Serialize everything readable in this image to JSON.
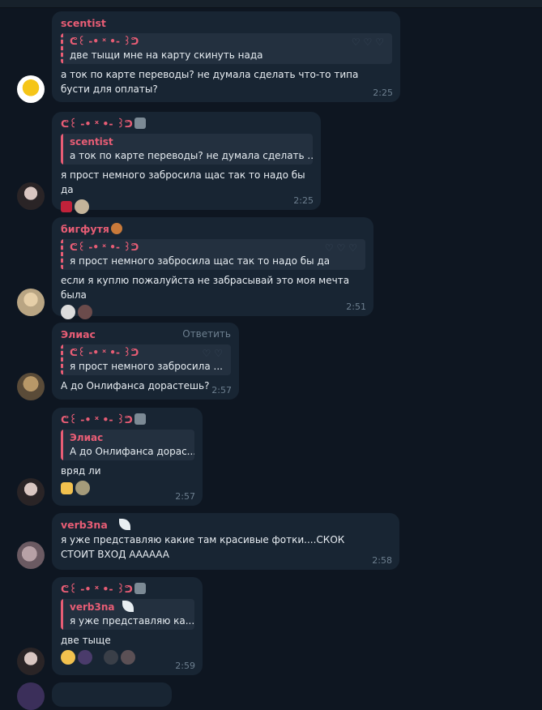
{
  "colors": {
    "background": "#0e1621",
    "bubble": "#182533",
    "accent": "#e85d75",
    "time": "#6d7f8f"
  },
  "messages": [
    {
      "sender": "scentist",
      "reply": {
        "author": "ᕦ꒰ -• ˣ •- ꒱ᕤ",
        "text": "две тыщи мне на карту скинуть нада"
      },
      "text": "а ток по карте переводы? не думала сделать что-то типа бусти для оплаты?",
      "time": "2:25"
    },
    {
      "sender": "ᕦ꒰ -• ˣ •- ꒱ᕤ",
      "reply": {
        "author": "scentist",
        "text": "а ток по карте переводы? не думала сделать ..."
      },
      "text": "я прост немного забросила щас так то надо бы да",
      "time": "2:25"
    },
    {
      "sender": "бигфутя",
      "reply": {
        "author": "ᕦ꒰ -• ˣ •- ꒱ᕤ",
        "text": "я прост немного забросила щас так то надо бы да"
      },
      "text": "если я куплю пожалуйста не забрасывай это моя мечта была",
      "time": "2:51"
    },
    {
      "sender": "Элиас",
      "reply_action": "Ответить",
      "reply": {
        "author": "ᕦ꒰ -• ˣ •- ꒱ᕤ",
        "text": "я прост немного забросила ..."
      },
      "text": "А до Онлифанса дорастешь?",
      "time": "2:57"
    },
    {
      "sender": "ᕦ꒰ -• ˣ •- ꒱ᕤ",
      "reply": {
        "author": "Элиас",
        "text": "А до Онлифанса дорас..."
      },
      "text": "вряд ли",
      "time": "2:57"
    },
    {
      "sender": "verb3na",
      "text": "я уже представляю какие там красивые фотки....СКОК СТОИТ ВХОД ААААAA",
      "time": "2:58"
    },
    {
      "sender": "ᕦ꒰ -• ˣ •- ꒱ᕤ",
      "reply": {
        "author": "verb3na",
        "text": "я уже представляю ка..."
      },
      "text": "две тыще",
      "time": "2:59"
    }
  ]
}
